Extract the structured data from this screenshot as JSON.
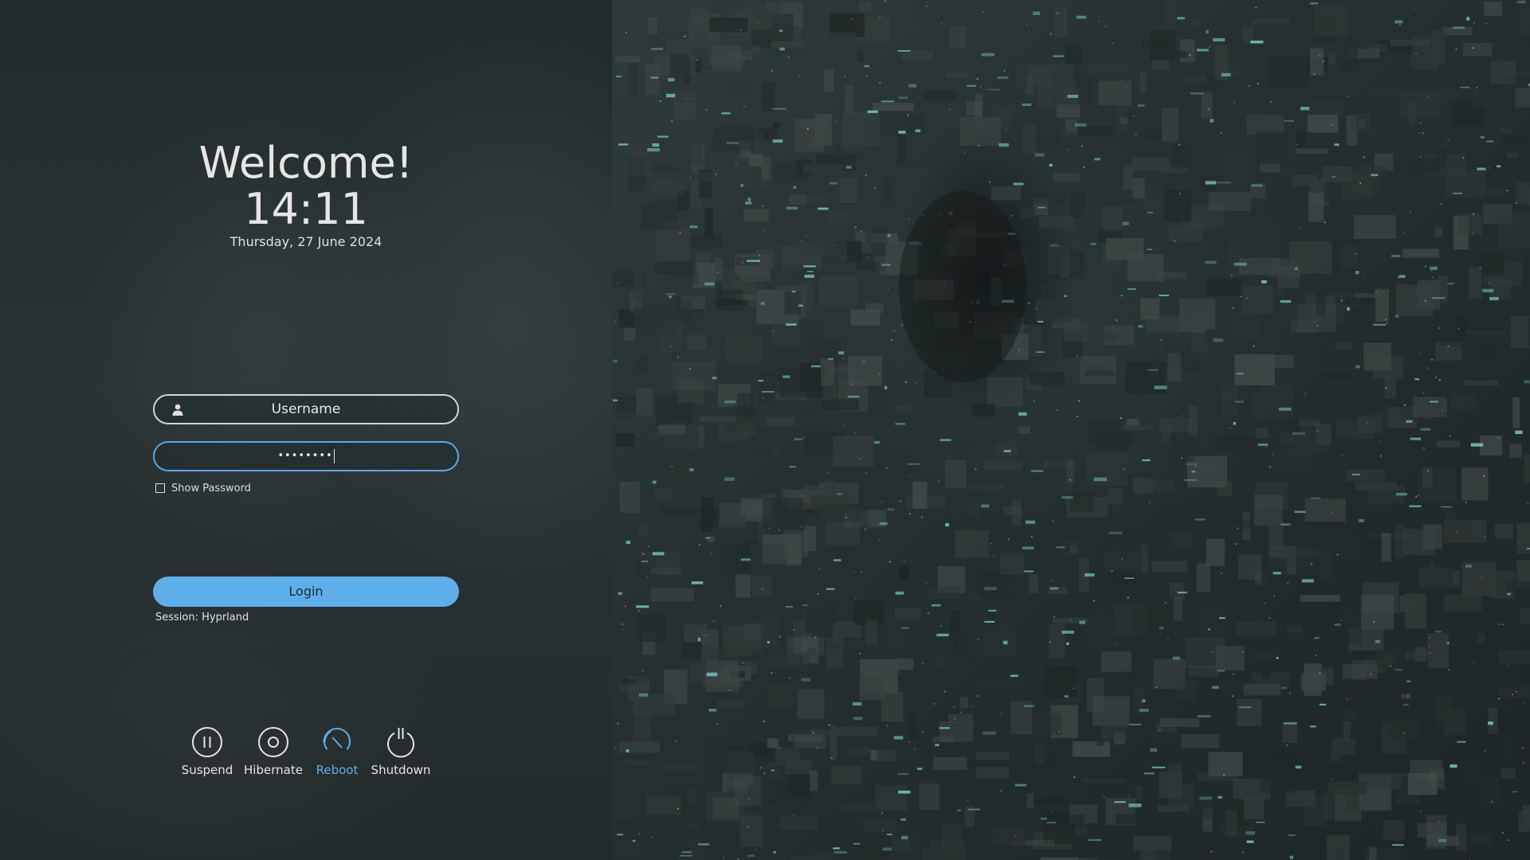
{
  "greeting": "Welcome!",
  "time": "14:11",
  "date": "Thursday, 27 June 2024",
  "login_form": {
    "username_placeholder": "Username",
    "password_masked": "••••••••",
    "show_password_label": "Show Password",
    "show_password_checked": false,
    "login_label": "Login",
    "session_text": "Session: Hyprland"
  },
  "power_actions": [
    {
      "label": "Suspend",
      "icon": "pause-icon",
      "active": false
    },
    {
      "label": "Hibernate",
      "icon": "circle-icon",
      "active": false
    },
    {
      "label": "Reboot",
      "icon": "reboot-icon",
      "active": true
    },
    {
      "label": "Shutdown",
      "icon": "power-icon",
      "active": false
    }
  ],
  "colors": {
    "accent": "#5eaeea",
    "panel_background": "#262f30",
    "text": "#e6e6e6"
  },
  "wallpaper": {
    "description_icon": "city-aerial-night-wallpaper"
  }
}
